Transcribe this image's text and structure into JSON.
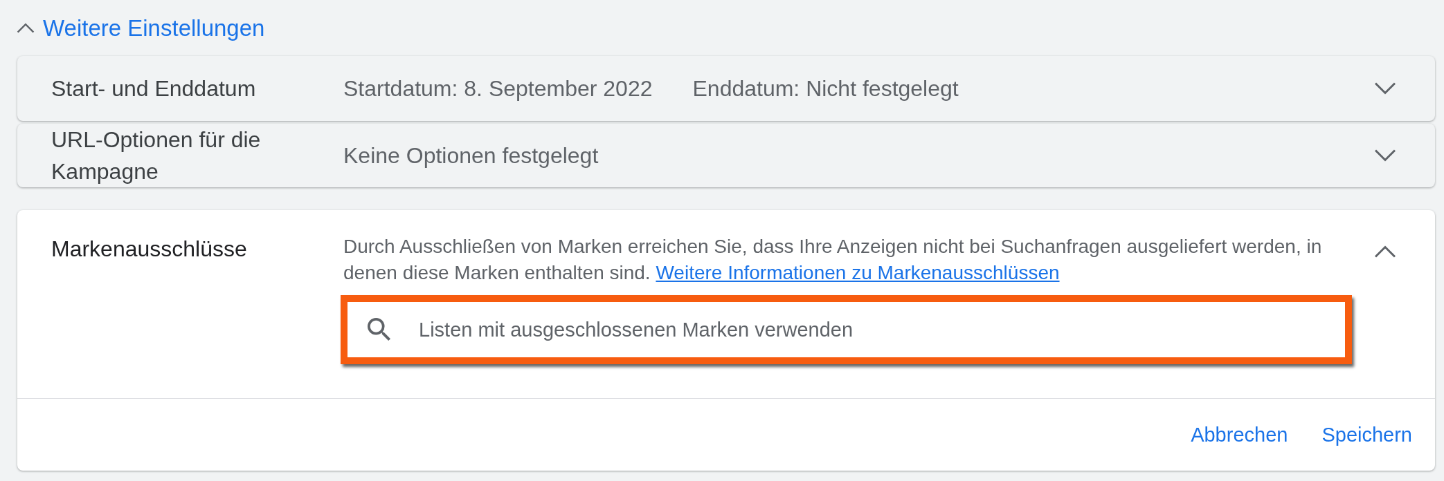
{
  "section": {
    "title": "Weitere Einstellungen",
    "expanded": true
  },
  "rows": [
    {
      "label": "Start- und Enddatum",
      "values": [
        "Startdatum: 8. September 2022",
        "Enddatum: Nicht festgelegt"
      ],
      "expanded": false
    },
    {
      "label": "URL-Optionen für die Kampagne",
      "values": [
        "Keine Optionen festgelegt"
      ],
      "expanded": false
    },
    {
      "label": "Markenausschlüsse",
      "expanded": true,
      "description": "Durch Ausschließen von Marken erreichen Sie, dass Ihre Anzeigen nicht bei Suchanfragen ausgeliefert werden, in denen diese Marken enthalten sind.",
      "link": "Weitere Informationen zu Markenausschlüssen",
      "search": {
        "placeholder": "Listen mit ausgeschlossenen Marken verwenden",
        "highlighted": true
      },
      "buttons": [
        "Abbrechen",
        "Speichern"
      ]
    }
  ]
}
